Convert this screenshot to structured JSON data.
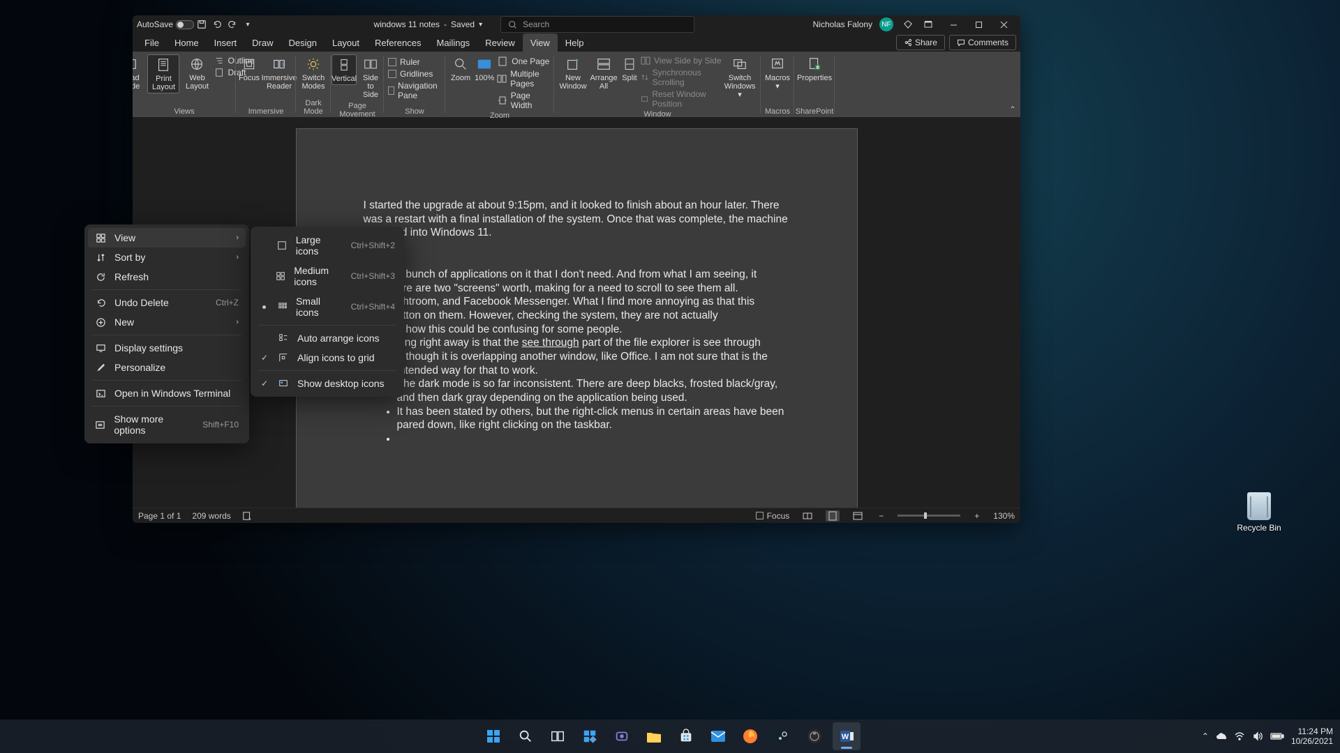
{
  "word": {
    "titlebar": {
      "autosave_label": "AutoSave",
      "autosave_toggle_state": "On",
      "doc_title": "windows 11 notes",
      "save_state": "Saved",
      "search_placeholder": "Search",
      "user_name": "Nicholas Falony",
      "user_initials": "NF"
    },
    "tabs": [
      "File",
      "Home",
      "Insert",
      "Draw",
      "Design",
      "Layout",
      "References",
      "Mailings",
      "Review",
      "View",
      "Help"
    ],
    "active_tab": "View",
    "share_label": "Share",
    "comments_label": "Comments",
    "ribbon": {
      "views": {
        "label": "Views",
        "read_mode": "Read Mode",
        "print_layout": "Print Layout",
        "web_layout": "Web Layout",
        "outline": "Outline",
        "draft": "Draft"
      },
      "immersive": {
        "label": "Immersive",
        "focus": "Focus",
        "immersive_reader": "Immersive Reader"
      },
      "darkmode": {
        "label": "Dark Mode",
        "switch_modes": "Switch Modes"
      },
      "page_movement": {
        "label": "Page Movement",
        "vertical": "Vertical",
        "side_to_side": "Side to Side"
      },
      "show": {
        "label": "Show",
        "ruler": "Ruler",
        "gridlines": "Gridlines",
        "navigation": "Navigation Pane"
      },
      "zoom": {
        "label": "Zoom",
        "zoom_btn": "Zoom",
        "one_hundred": "100%",
        "one_page": "One Page",
        "multiple_pages": "Multiple Pages",
        "page_width": "Page Width"
      },
      "window": {
        "label": "Window",
        "new_window": "New Window",
        "arrange_all": "Arrange All",
        "split": "Split",
        "view_side_by_side": "View Side by Side",
        "synchronous": "Synchronous Scrolling",
        "reset_window": "Reset Window Position",
        "switch_windows": "Switch Windows"
      },
      "macros": {
        "label": "Macros",
        "macros_btn": "Macros"
      },
      "sharepoint": {
        "label": "SharePoint",
        "properties": "Properties"
      }
    },
    "document": {
      "para1": "I started the upgrade at about 9:15pm, and it looked to finish about an hour later. There was a restart with a final installation of the system. Once that was complete, the machine launched into Windows 11.",
      "bullet1_a": "a bunch of applications on it that I don't need. And from what I am seeing, it",
      "bullet1_b": "ere are two \"screens\" worth, making for a need to scroll to see them all.",
      "bullet1_c": "ghtroom, and Facebook Messenger. What I find more annoying as that this",
      "bullet1_d": "utton on them. However, checking the system, they are not actually",
      "bullet1_e": "e how this could be confusing for some people.",
      "bullet2_a": "cing right away is that the ",
      "bullet2_link": "see through",
      "bullet2_b": " part of the file explorer is see through",
      "bullet2_c": "n though it is overlapping another window, like Office. I am not sure that is the intended way for that to work.",
      "bullet3": "The dark mode is so far inconsistent. There are deep blacks, frosted black/gray, and then dark gray depending on the application being used.",
      "bullet4": "It has been stated by others, but the right-click menus in certain areas have been pared down, like right clicking on the taskbar."
    },
    "statusbar": {
      "page": "Page 1 of 1",
      "words": "209 words",
      "focus": "Focus",
      "zoom": "130%"
    }
  },
  "context_menu": {
    "primary": [
      {
        "icon": "grid",
        "label": "View",
        "sub": true,
        "hover": true
      },
      {
        "icon": "sort",
        "label": "Sort by",
        "sub": true
      },
      {
        "icon": "refresh",
        "label": "Refresh"
      },
      {
        "sep": true
      },
      {
        "icon": "undo",
        "label": "Undo Delete",
        "shortcut": "Ctrl+Z"
      },
      {
        "icon": "new",
        "label": "New",
        "sub": true
      },
      {
        "sep": true
      },
      {
        "icon": "display",
        "label": "Display settings"
      },
      {
        "icon": "person",
        "label": "Personalize"
      },
      {
        "sep": true
      },
      {
        "icon": "terminal",
        "label": "Open in Windows Terminal"
      },
      {
        "sep": true
      },
      {
        "icon": "more",
        "label": "Show more options",
        "shortcut": "Shift+F10"
      }
    ],
    "view_sub": [
      {
        "label": "Large icons",
        "shortcut": "Ctrl+Shift+2",
        "icon": "grid-lg"
      },
      {
        "label": "Medium icons",
        "shortcut": "Ctrl+Shift+3",
        "icon": "grid-md"
      },
      {
        "label": "Small icons",
        "shortcut": "Ctrl+Shift+4",
        "icon": "grid-sm",
        "bullet": true
      },
      {
        "sep": true
      },
      {
        "label": "Auto arrange icons",
        "icon": "auto"
      },
      {
        "label": "Align icons to grid",
        "icon": "align",
        "check": true
      },
      {
        "sep": true
      },
      {
        "label": "Show desktop icons",
        "icon": "show",
        "check": true
      }
    ]
  },
  "desktop": {
    "recycle_bin": "Recycle Bin"
  },
  "taskbar": {
    "time": "11:24 PM",
    "date": "10/26/2021"
  }
}
